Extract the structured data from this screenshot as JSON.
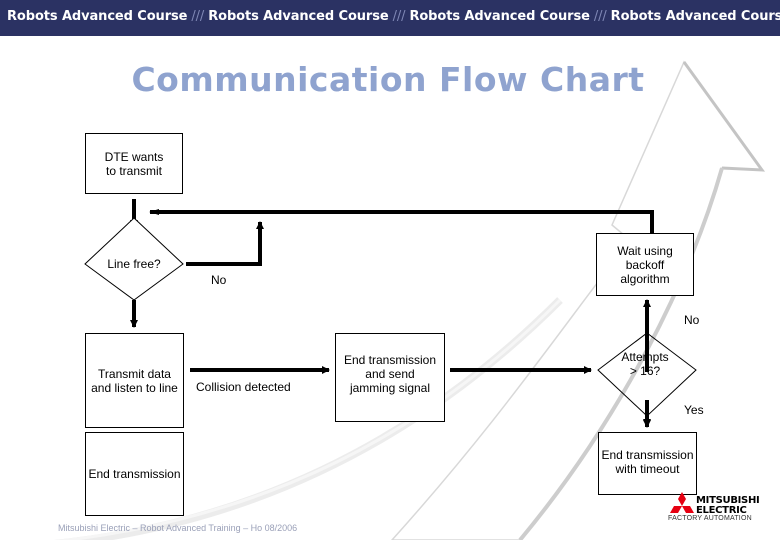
{
  "header": {
    "banner_segments": [
      "Robots Advanced Course",
      "Robots Advanced Course",
      "Robots Advanced Course",
      "Robots Advanced Course"
    ],
    "separator": "///"
  },
  "slide": {
    "title": "Communication Flow Chart"
  },
  "flowchart": {
    "nodes": {
      "start": {
        "type": "process",
        "text": "DTE wants to transmit"
      },
      "line_free": {
        "type": "decision",
        "text": "Line free?"
      },
      "backoff": {
        "type": "process",
        "text": "Wait using backoff algorithm"
      },
      "transmit": {
        "type": "process",
        "text": "Transmit data and listen to line"
      },
      "jam": {
        "type": "process",
        "text": "End transmission and send jamming signal"
      },
      "attempts": {
        "type": "decision",
        "text": "Attempts > 16?"
      },
      "end": {
        "type": "process",
        "text": "End transmission"
      },
      "timeout": {
        "type": "process",
        "text": "End transmission with timeout"
      }
    },
    "edges": [
      {
        "from": "start",
        "to": "line_free",
        "label": ""
      },
      {
        "from": "line_free",
        "to": "line_free",
        "label": "No"
      },
      {
        "from": "line_free",
        "to": "transmit",
        "label": ""
      },
      {
        "from": "transmit",
        "to": "jam",
        "label": "Collision detected"
      },
      {
        "from": "transmit",
        "to": "end",
        "label": ""
      },
      {
        "from": "jam",
        "to": "attempts",
        "label": ""
      },
      {
        "from": "attempts",
        "to": "backoff",
        "label": "No"
      },
      {
        "from": "attempts",
        "to": "timeout",
        "label": "Yes"
      },
      {
        "from": "backoff",
        "to": "line_free",
        "label": ""
      }
    ],
    "labels": {
      "line_free_no": "No",
      "collision": "Collision detected",
      "attempts_no": "No",
      "attempts_yes": "Yes"
    }
  },
  "footer": {
    "text": "Mitsubishi Electric – Robot Advanced Training – Ho 08/2006"
  },
  "logo": {
    "name_line1": "MITSUBISHI",
    "name_line2": "ELECTRIC",
    "tagline": "FACTORY AUTOMATION",
    "color": "#e60012"
  },
  "colors": {
    "banner": "#2b3263",
    "title": "#8fa3cf"
  }
}
